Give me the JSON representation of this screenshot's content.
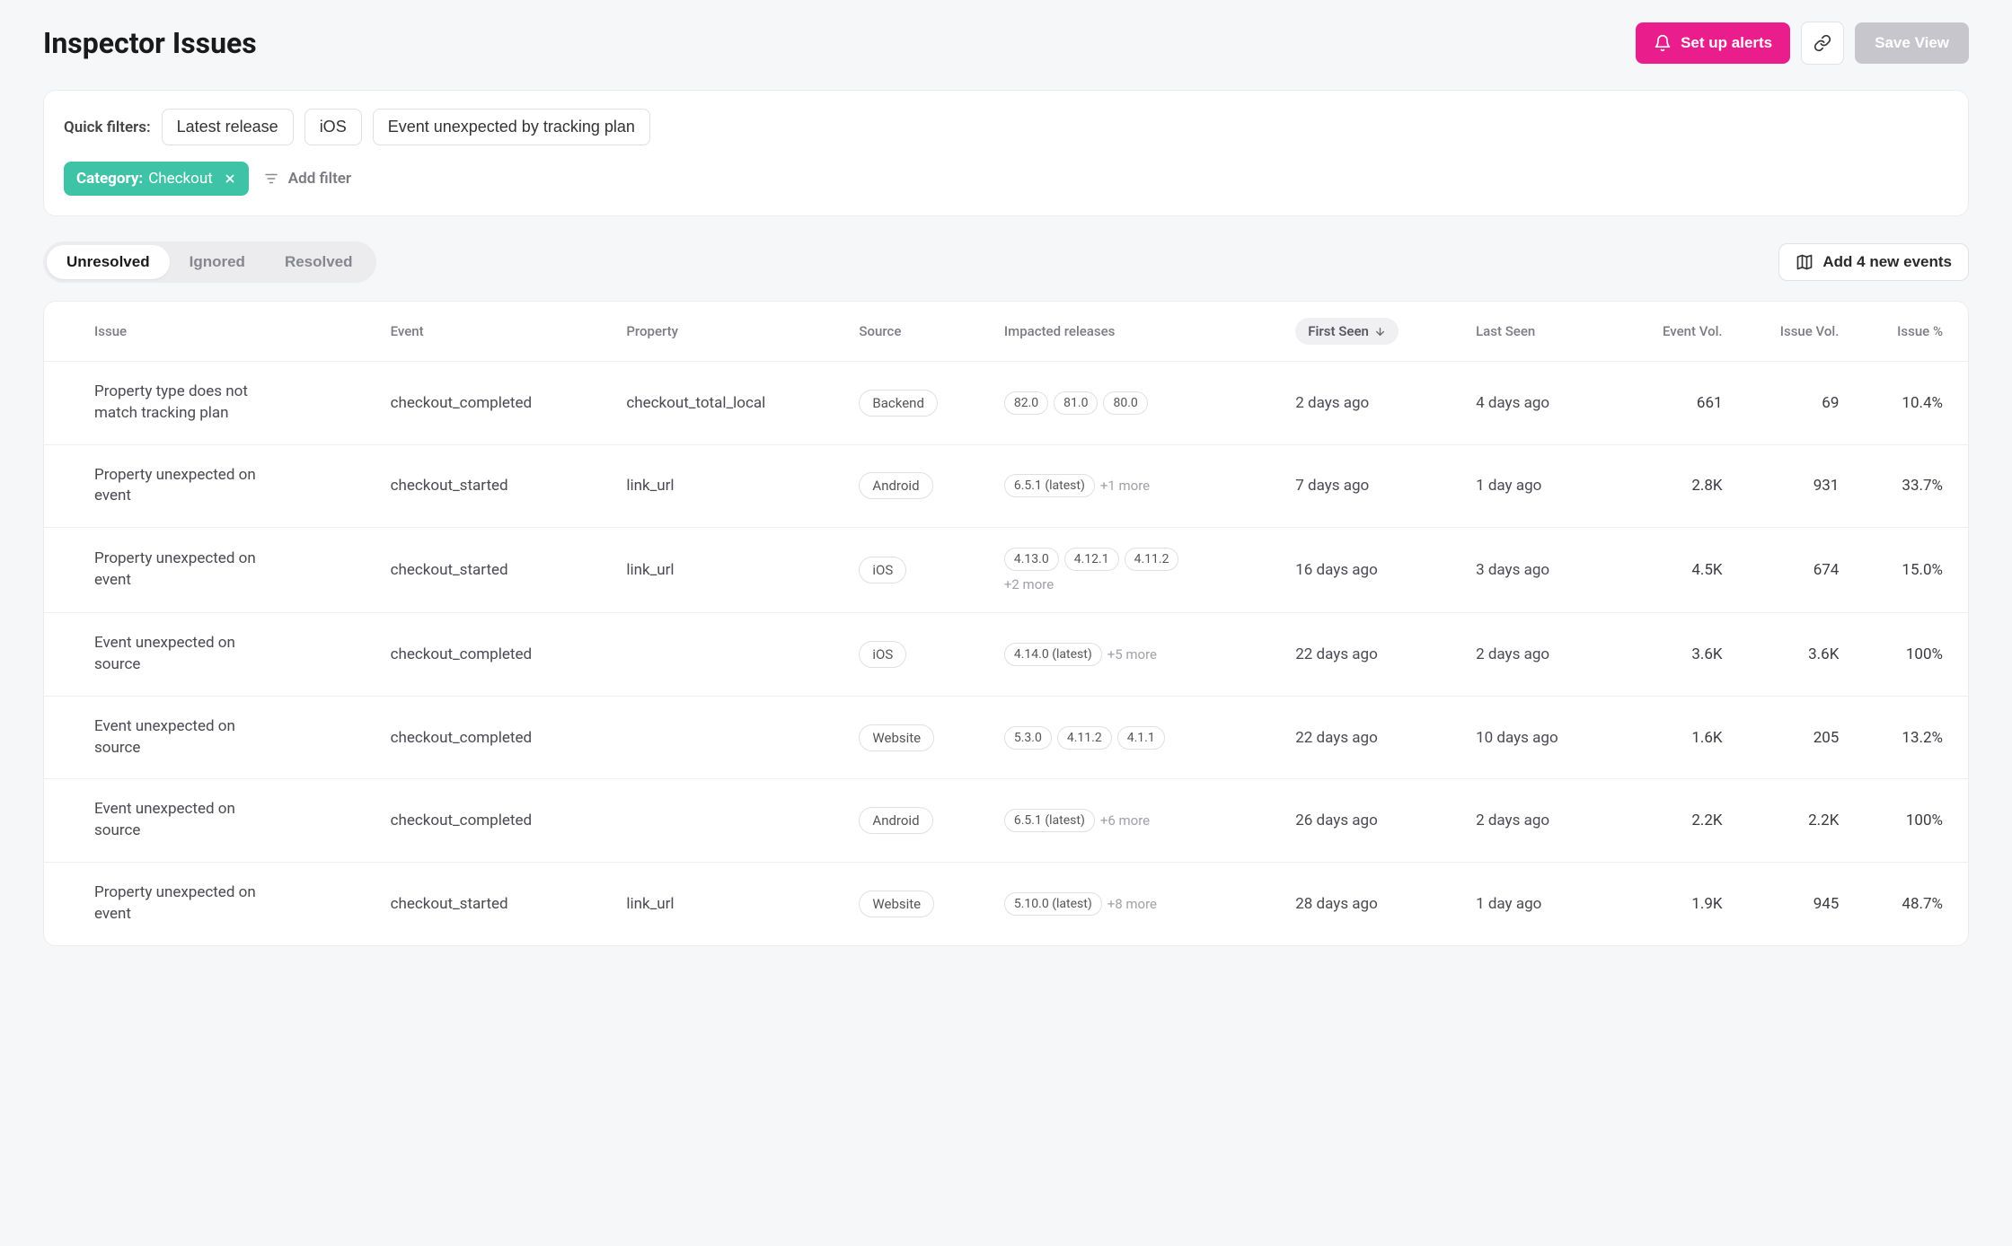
{
  "header": {
    "title": "Inspector Issues",
    "setup_alerts": "Set up alerts",
    "save_view": "Save View"
  },
  "filters": {
    "quick_label": "Quick filters:",
    "quick_chips": [
      "Latest release",
      "iOS",
      "Event unexpected by tracking plan"
    ],
    "applied": {
      "key": "Category:",
      "value": "Checkout"
    },
    "add_filter": "Add filter"
  },
  "tabs": {
    "unresolved": "Unresolved",
    "ignored": "Ignored",
    "resolved": "Resolved"
  },
  "add_events": "Add 4 new events",
  "columns": {
    "issue": "Issue",
    "event": "Event",
    "property": "Property",
    "source": "Source",
    "impacted": "Impacted releases",
    "first_seen": "First Seen",
    "last_seen": "Last Seen",
    "event_vol": "Event Vol.",
    "issue_vol": "Issue Vol.",
    "issue_pct": "Issue %"
  },
  "rows": [
    {
      "issue": "Property type does not match tracking plan",
      "event": "checkout_completed",
      "property": "checkout_total_local",
      "source": "Backend",
      "releases": [
        "82.0",
        "81.0",
        "80.0"
      ],
      "more": "",
      "first_seen": "2 days ago",
      "last_seen": "4 days ago",
      "event_vol": "661",
      "issue_vol": "69",
      "issue_pct": "10.4%"
    },
    {
      "issue": "Property unexpected on event",
      "event": "checkout_started",
      "property": "link_url",
      "source": "Android",
      "releases": [
        "6.5.1 (latest)"
      ],
      "more": "+1 more",
      "first_seen": "7 days ago",
      "last_seen": "1 day ago",
      "event_vol": "2.8K",
      "issue_vol": "931",
      "issue_pct": "33.7%"
    },
    {
      "issue": "Property unexpected on event",
      "event": "checkout_started",
      "property": "link_url",
      "source": "iOS",
      "releases": [
        "4.13.0",
        "4.12.1",
        "4.11.2"
      ],
      "more": "+2 more",
      "first_seen": "16 days ago",
      "last_seen": "3 days ago",
      "event_vol": "4.5K",
      "issue_vol": "674",
      "issue_pct": "15.0%"
    },
    {
      "issue": "Event unexpected on source",
      "event": "checkout_completed",
      "property": "",
      "source": "iOS",
      "releases": [
        "4.14.0 (latest)"
      ],
      "more": "+5 more",
      "first_seen": "22 days ago",
      "last_seen": "2 days ago",
      "event_vol": "3.6K",
      "issue_vol": "3.6K",
      "issue_pct": "100%"
    },
    {
      "issue": "Event unexpected on source",
      "event": "checkout_completed",
      "property": "",
      "source": "Website",
      "releases": [
        "5.3.0",
        "4.11.2",
        "4.1.1"
      ],
      "more": "",
      "first_seen": "22 days ago",
      "last_seen": "10 days ago",
      "event_vol": "1.6K",
      "issue_vol": "205",
      "issue_pct": "13.2%"
    },
    {
      "issue": "Event unexpected on source",
      "event": "checkout_completed",
      "property": "",
      "source": "Android",
      "releases": [
        "6.5.1 (latest)"
      ],
      "more": "+6 more",
      "first_seen": "26 days ago",
      "last_seen": "2 days ago",
      "event_vol": "2.2K",
      "issue_vol": "2.2K",
      "issue_pct": "100%"
    },
    {
      "issue": "Property unexpected on event",
      "event": "checkout_started",
      "property": "link_url",
      "source": "Website",
      "releases": [
        "5.10.0 (latest)"
      ],
      "more": "+8 more",
      "first_seen": "28 days ago",
      "last_seen": "1 day ago",
      "event_vol": "1.9K",
      "issue_vol": "945",
      "issue_pct": "48.7%"
    }
  ]
}
